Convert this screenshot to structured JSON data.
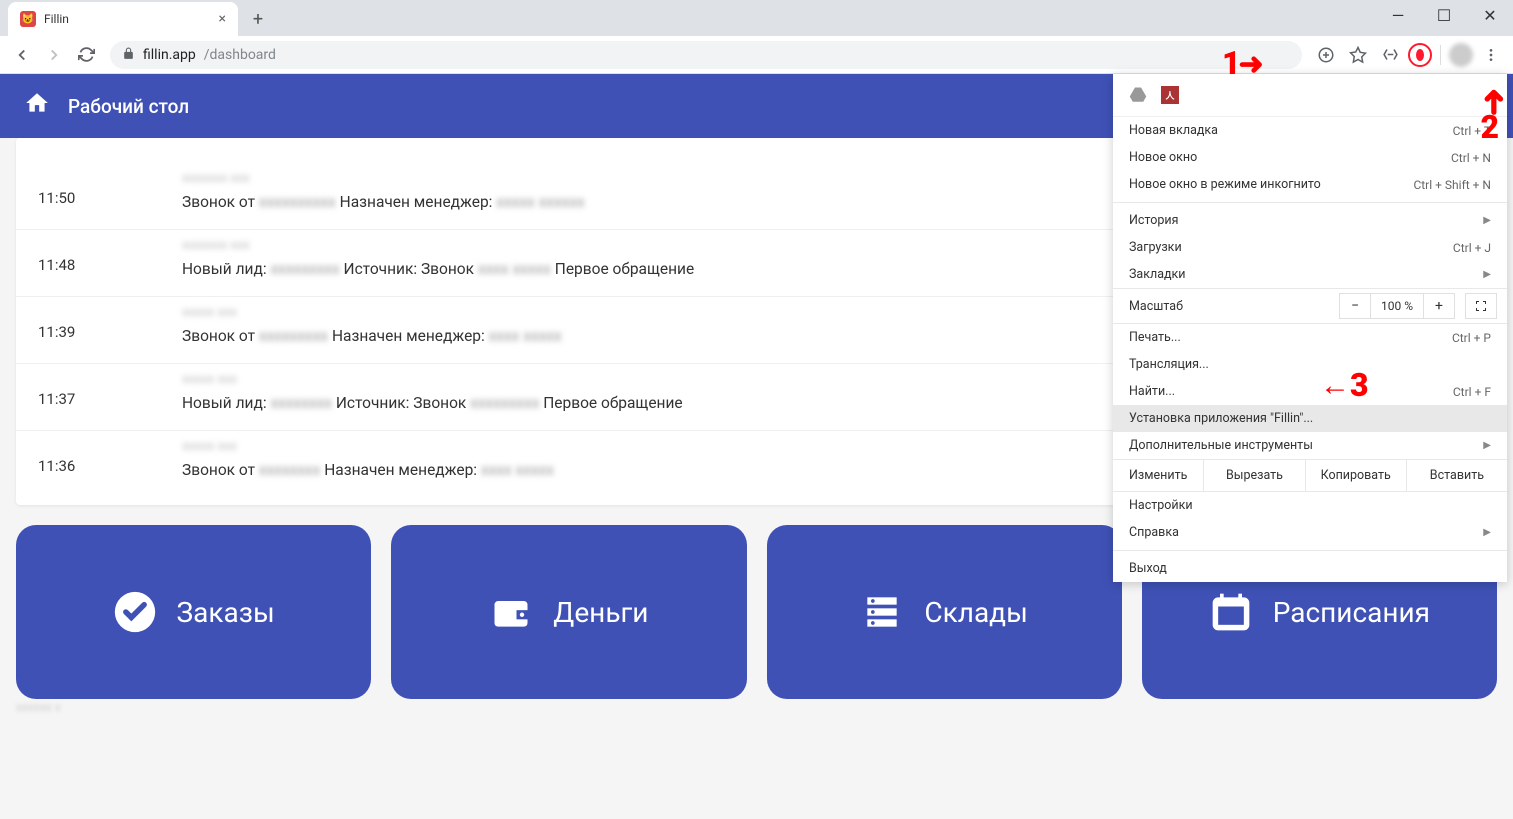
{
  "browser": {
    "tab_title": "Fillin",
    "url_host": "fillin.app",
    "url_path": "/dashboard"
  },
  "app": {
    "header_title": "Рабочий стол"
  },
  "feed": [
    {
      "time": "11:50",
      "top": "xxxxxxx xxx",
      "line": "Звонок от",
      "blur1": "xxxxxxxxxx",
      "mid": "Назначен менеджер:",
      "blur2": "xxxxx xxxxxx"
    },
    {
      "time": "11:48",
      "top": "xxxxxxx xxx",
      "line": "Новый лид:",
      "blur1": "xxxxxxxxx",
      "mid": "Источник: Звонок",
      "blur2": "xxxx xxxxx",
      "tail": "Первое обращение"
    },
    {
      "time": "11:39",
      "top": "xxxxx xxx",
      "line": "Звонок от",
      "blur1": "xxxxxxxxx",
      "mid": "Назначен менеджер:",
      "blur2": "xxxx xxxxx"
    },
    {
      "time": "11:37",
      "top": "xxxxx xxx",
      "line": "Новый лид:",
      "blur1": "xxxxxxxx",
      "mid": "Источник: Звонок",
      "blur2": "xxxxxxxxx",
      "tail": "Первое обращение"
    },
    {
      "time": "11:36",
      "top": "xxxxx xxx",
      "line": "Звонок от",
      "blur1": "xxxxxxxx",
      "mid": "Назначен менеджер:",
      "blur2": "xxxx xxxxx"
    }
  ],
  "tiles": [
    {
      "label": "Заказы",
      "icon": "check"
    },
    {
      "label": "Деньги",
      "icon": "wallet"
    },
    {
      "label": "Склады",
      "icon": "storage"
    },
    {
      "label": "Расписания",
      "icon": "calendar"
    }
  ],
  "menu": {
    "new_tab": "Новая вкладка",
    "new_tab_k": "Ctrl + T",
    "new_window": "Новое окно",
    "new_window_k": "Ctrl + N",
    "incognito": "Новое окно в режиме инкогнито",
    "incognito_k": "Ctrl + Shift + N",
    "history": "История",
    "downloads": "Загрузки",
    "downloads_k": "Ctrl + J",
    "bookmarks": "Закладки",
    "zoom_label": "Масштаб",
    "zoom_value": "100 %",
    "print": "Печать...",
    "print_k": "Ctrl + P",
    "cast": "Трансляция...",
    "find": "Найти...",
    "find_k": "Ctrl + F",
    "install": "Установка приложения \"Fillin\"...",
    "more_tools": "Дополнительные инструменты",
    "edit": "Изменить",
    "cut": "Вырезать",
    "copy": "Копировать",
    "paste": "Вставить",
    "settings": "Настройки",
    "help": "Справка",
    "exit": "Выход"
  },
  "annotations": {
    "a1": "1",
    "a2": "2",
    "a3": "3"
  },
  "footer": "xxxxxx x"
}
